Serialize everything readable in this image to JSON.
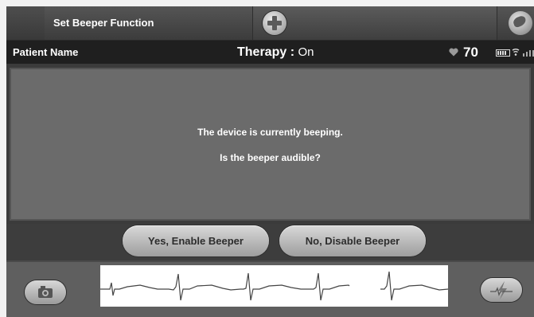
{
  "header": {
    "title": "Set Beeper Function",
    "add_icon": "plus-icon",
    "globe_icon": "globe-icon"
  },
  "status": {
    "patient_name": "Patient Name",
    "therapy_label": "Therapy : ",
    "therapy_value": "On",
    "heart_rate": "70"
  },
  "message": {
    "line1": "The device is currently beeping.",
    "line2": "Is the beeper audible?"
  },
  "buttons": {
    "yes": "Yes, Enable Beeper",
    "no": "No, Disable Beeper"
  },
  "bottom": {
    "camera_icon": "camera-icon",
    "pulse_icon": "pulse-icon"
  }
}
